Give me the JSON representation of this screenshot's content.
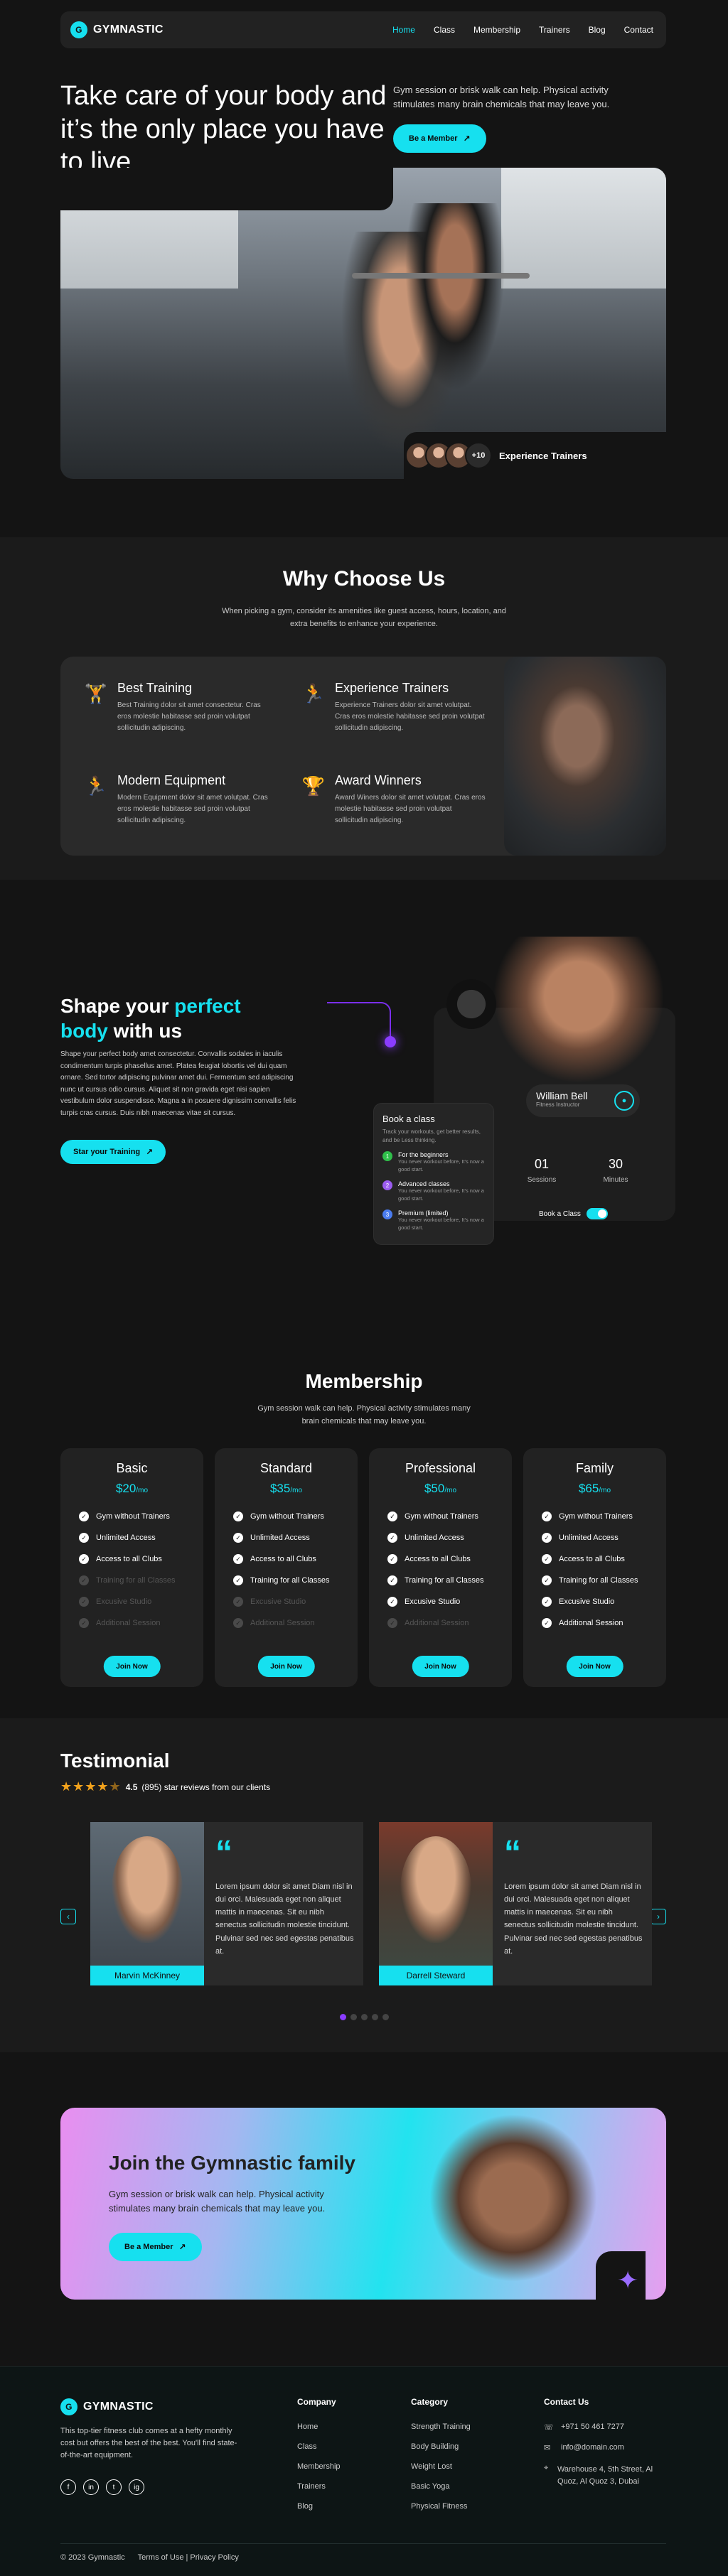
{
  "brand": {
    "name": "GYMNASTIC",
    "mark": "G"
  },
  "colors": {
    "accent": "#16e0ef",
    "purple": "#8a3cff",
    "bg": "#141414"
  },
  "nav": {
    "items": [
      {
        "label": "Home",
        "active": true
      },
      {
        "label": "Class"
      },
      {
        "label": "Membership"
      },
      {
        "label": "Trainers"
      },
      {
        "label": "Blog"
      },
      {
        "label": "Contact"
      }
    ]
  },
  "hero": {
    "title": "Take care of your body and it’s the only place you have to live",
    "subtitle": "Gym session or brisk walk can help. Physical activity stimulates many brain chemicals that may leave you.",
    "cta": "Be a Member",
    "trainers_more": "+10",
    "trainers_label": "Experience Trainers"
  },
  "why": {
    "title": "Why Choose Us",
    "subtitle": "When picking a gym, consider its amenities like guest access, hours, location, and extra benefits to enhance your experience.",
    "features": [
      {
        "icon": "dumbbell-icon",
        "title": "Best Training",
        "text": "Best Training dolor sit amet consectetur. Cras eros molestie habitasse sed proin volutpat sollicitudin adipiscing."
      },
      {
        "icon": "treadmill-icon",
        "title": "Experience Trainers",
        "text": "Experience Trainers dolor sit amet volutpat. Cras eros molestie habitasse sed proin volutpat sollicitudin adipiscing."
      },
      {
        "icon": "treadmill-icon",
        "title": "Modern Equipment",
        "text": "Modern Equipment dolor sit amet volutpat. Cras eros molestie habitasse sed proin volutpat sollicitudin adipiscing."
      },
      {
        "icon": "trophy-icon",
        "title": "Award Winners",
        "text": "Award Winers dolor sit amet volutpat. Cras eros molestie habitasse sed proin volutpat sollicitudin adipiscing."
      }
    ]
  },
  "shape": {
    "title_part1": "Shape your ",
    "title_highlight1": "perfect",
    "title_highlight2": "body",
    "title_part2": " with us",
    "body": "Shape your perfect body amet consectetur. Convallis sodales in iaculis condimentum turpis phasellus amet. Platea feugiat lobortis vel dui quam ornare. Sed tortor adipiscing pulvinar amet dui. Fermentum sed adipiscing nunc ut cursus odio cursus. Aliquet sit non gravida eget nisi sapien vestibulum dolor suspendisse. Magna a in posuere dignissim convallis felis turpis cras cursus. Duis nibh maecenas vitae sit cursus.",
    "cta": "Star your Training",
    "trainer_name": "William Bell",
    "trainer_role": "Fitness Instructor",
    "stats": [
      {
        "value": "01",
        "label": "Sessions"
      },
      {
        "value": "30",
        "label": "Minutes"
      }
    ],
    "toggle_label": "Book a Class",
    "book": {
      "title": "Book a class",
      "subtitle": "Track your workouts, get better results, and be Less thinking.",
      "items": [
        {
          "n": "1",
          "color": "#2fbf4a",
          "title": "For the beginners",
          "desc": "You never workout before, It's now a good start."
        },
        {
          "n": "2",
          "color": "#9b5cf0",
          "title": "Advanced classes",
          "desc": "You never workout before, It's now a good start."
        },
        {
          "n": "3",
          "color": "#4a7cf0",
          "title": "Premium (limited)",
          "desc": "You never workout before, It's now a good start."
        }
      ]
    }
  },
  "membership": {
    "title": "Membership",
    "subtitle": "Gym session walk can help. Physical activity stimulates many brain chemicals that may leave you.",
    "per": "/mo",
    "join_label": "Join Now",
    "plans": [
      {
        "name": "Basic",
        "price": "$20",
        "features": [
          {
            "t": "Gym without Trainers",
            "on": true
          },
          {
            "t": "Unlimited Access",
            "on": true
          },
          {
            "t": "Access to all Clubs",
            "on": true
          },
          {
            "t": "Training for all Classes",
            "on": false
          },
          {
            "t": "Excusive Studio",
            "on": false
          },
          {
            "t": "Additional Session",
            "on": false
          }
        ]
      },
      {
        "name": "Standard",
        "price": "$35",
        "features": [
          {
            "t": "Gym without Trainers",
            "on": true
          },
          {
            "t": "Unlimited Access",
            "on": true
          },
          {
            "t": "Access to all Clubs",
            "on": true
          },
          {
            "t": "Training for all Classes",
            "on": true
          },
          {
            "t": "Excusive Studio",
            "on": false
          },
          {
            "t": "Additional Session",
            "on": false
          }
        ]
      },
      {
        "name": "Professional",
        "price": "$50",
        "features": [
          {
            "t": "Gym without Trainers",
            "on": true
          },
          {
            "t": "Unlimited Access",
            "on": true
          },
          {
            "t": "Access to all Clubs",
            "on": true
          },
          {
            "t": "Training for all Classes",
            "on": true
          },
          {
            "t": "Excusive Studio",
            "on": true
          },
          {
            "t": "Additional Session",
            "on": false
          }
        ]
      },
      {
        "name": "Family",
        "price": "$65",
        "features": [
          {
            "t": "Gym without Trainers",
            "on": true
          },
          {
            "t": "Unlimited Access",
            "on": true
          },
          {
            "t": "Access to all Clubs",
            "on": true
          },
          {
            "t": "Training for all Classes",
            "on": true
          },
          {
            "t": "Excusive Studio",
            "on": true
          },
          {
            "t": "Additional Session",
            "on": true
          }
        ]
      }
    ]
  },
  "testimonial": {
    "title": "Testimonial",
    "rating_value": "4.5",
    "rating_rest": "(895) star reviews from our clients",
    "stars": "★★★★",
    "half_star": "★",
    "quote_mark": "“",
    "cards": [
      {
        "name": "Marvin McKinney",
        "text": "Lorem ipsum dolor sit amet Diam nisl in dui orci. Malesuada eget non aliquet mattis in maecenas. Sit eu nibh senectus sollicitudin molestie tincidunt. Pulvinar sed nec sed egestas penatibus at."
      },
      {
        "name": "Darrell Steward",
        "text": "Lorem ipsum dolor sit amet Diam nisl in dui orci. Malesuada eget non aliquet mattis in maecenas. Sit eu nibh senectus sollicitudin molestie tincidunt. Pulvinar sed nec sed egestas penatibus at."
      }
    ],
    "prev": "‹",
    "next": "›"
  },
  "join": {
    "title": "Join the Gymnastic family",
    "subtitle": "Gym session or brisk walk can help. Physical activity stimulates many brain chemicals that may leave you.",
    "cta": "Be a Member"
  },
  "footer": {
    "desc": "This top-tier fitness club comes at a hefty monthly cost but offers the best of the best. You'll find state-of-the-art equipment.",
    "social": [
      "f",
      "in",
      "t",
      "ig"
    ],
    "company": {
      "title": "Company",
      "items": [
        "Home",
        "Class",
        "Membership",
        "Trainers",
        "Blog"
      ]
    },
    "category": {
      "title": "Category",
      "items": [
        "Strength Training",
        "Body Building",
        "Weight Lost",
        "Basic Yoga",
        "Physical Fitness"
      ]
    },
    "contact": {
      "title": "Contact Us",
      "phone": "+971 50 461 7277",
      "email": "info@domain.com",
      "address": "Warehouse 4, 5th Street, Al Quoz, Al Quoz 3, Dubai"
    },
    "copyright": "© 2023 Gymnastic",
    "links": "Terms of Use | Privacy Policy"
  }
}
